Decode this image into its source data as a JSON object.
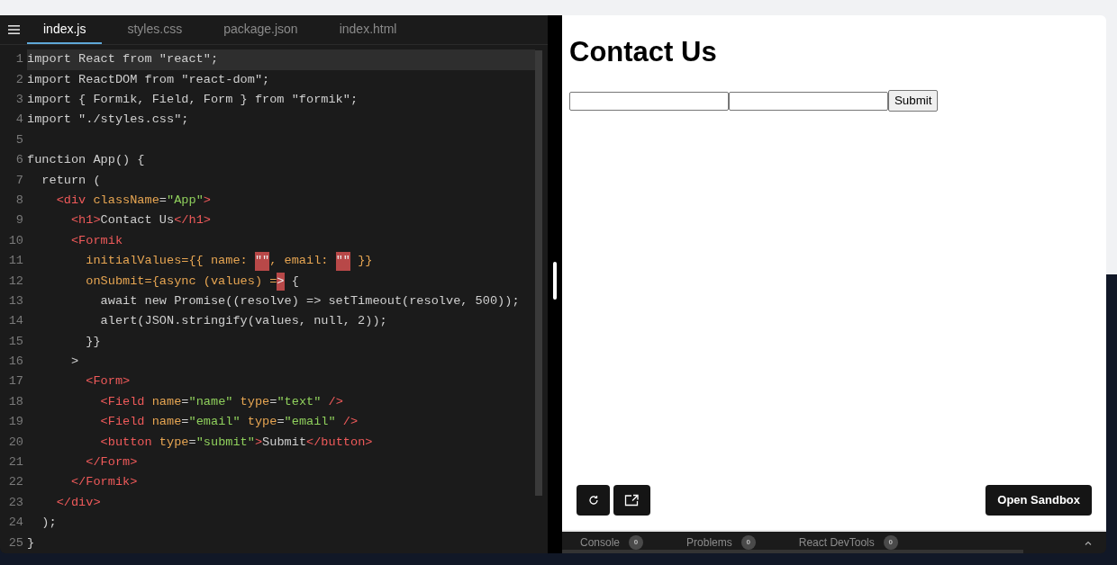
{
  "editor": {
    "tabs": [
      {
        "label": "index.js",
        "selected": true
      },
      {
        "label": "styles.css",
        "selected": false
      },
      {
        "label": "package.json",
        "selected": false
      },
      {
        "label": "index.html",
        "selected": false
      }
    ],
    "lines": [
      {
        "number": "1",
        "active": true,
        "tokens": [
          {
            "kind": "plain",
            "text": "import React from \"react\";"
          }
        ]
      },
      {
        "number": "2",
        "active": false,
        "tokens": [
          {
            "kind": "plain",
            "text": "import ReactDOM from \"react-dom\";"
          }
        ]
      },
      {
        "number": "3",
        "active": false,
        "tokens": [
          {
            "kind": "plain",
            "text": "import { Formik, Field, Form } from \"formik\";"
          }
        ]
      },
      {
        "number": "4",
        "active": false,
        "tokens": [
          {
            "kind": "plain",
            "text": "import \"./styles.css\";"
          }
        ]
      },
      {
        "number": "5",
        "active": false
      },
      {
        "number": "6",
        "active": false,
        "tokens": [
          {
            "kind": "plain",
            "text": "function App() {"
          }
        ]
      },
      {
        "number": "7",
        "active": false,
        "tokens": [
          {
            "kind": "plain",
            "text": "  return ("
          }
        ]
      },
      {
        "number": "8",
        "active": false,
        "tokens": [
          {
            "kind": "tag",
            "text": "    <div "
          },
          {
            "kind": "attr",
            "text": "className"
          },
          {
            "kind": "plain",
            "text": "="
          },
          {
            "kind": "string",
            "text": "\"App\""
          },
          {
            "kind": "tag",
            "text": ">"
          }
        ]
      },
      {
        "number": "9",
        "active": false,
        "tokens": [
          {
            "kind": "tag",
            "text": "      <h1>"
          },
          {
            "kind": "plain",
            "text": "Contact Us"
          },
          {
            "kind": "tag",
            "text": "</h1>"
          }
        ]
      },
      {
        "number": "10",
        "active": false,
        "tokens": [
          {
            "kind": "tag",
            "text": "      <Formik"
          }
        ]
      },
      {
        "number": "11",
        "active": false,
        "tokens": [
          {
            "kind": "attr",
            "text": "        initialValues={{ name: "
          },
          {
            "kind": "error",
            "text": "\"\""
          },
          {
            "kind": "attr",
            "text": ", email: "
          },
          {
            "kind": "error",
            "text": "\"\""
          },
          {
            "kind": "attr",
            "text": " }}"
          }
        ]
      },
      {
        "number": "12",
        "active": false,
        "tokens": [
          {
            "kind": "attr",
            "text": "        onSubmit={async (values) ="
          },
          {
            "kind": "error",
            "text": ">"
          },
          {
            "kind": "plain",
            "text": " {"
          }
        ]
      },
      {
        "number": "13",
        "active": false,
        "tokens": [
          {
            "kind": "plain",
            "text": "          await new Promise((resolve) => setTimeout(resolve, 500));"
          }
        ]
      },
      {
        "number": "14",
        "active": false,
        "tokens": [
          {
            "kind": "plain",
            "text": "          alert(JSON.stringify(values, null, 2));"
          }
        ]
      },
      {
        "number": "15",
        "active": false,
        "tokens": [
          {
            "kind": "plain",
            "text": "        }}"
          }
        ]
      },
      {
        "number": "16",
        "active": false,
        "tokens": [
          {
            "kind": "plain",
            "text": "      >"
          }
        ]
      },
      {
        "number": "17",
        "active": false,
        "tokens": [
          {
            "kind": "tag",
            "text": "        <Form>"
          }
        ]
      },
      {
        "number": "18",
        "active": false,
        "tokens": [
          {
            "kind": "tag",
            "text": "          <Field "
          },
          {
            "kind": "attr",
            "text": "name"
          },
          {
            "kind": "plain",
            "text": "="
          },
          {
            "kind": "string",
            "text": "\"name\" "
          },
          {
            "kind": "attr",
            "text": "type"
          },
          {
            "kind": "plain",
            "text": "="
          },
          {
            "kind": "string",
            "text": "\"text\" "
          },
          {
            "kind": "tag",
            "text": "/>"
          }
        ]
      },
      {
        "number": "19",
        "active": false,
        "tokens": [
          {
            "kind": "tag",
            "text": "          <Field "
          },
          {
            "kind": "attr",
            "text": "name"
          },
          {
            "kind": "plain",
            "text": "="
          },
          {
            "kind": "string",
            "text": "\"email\" "
          },
          {
            "kind": "attr",
            "text": "type"
          },
          {
            "kind": "plain",
            "text": "="
          },
          {
            "kind": "string",
            "text": "\"email\" "
          },
          {
            "kind": "tag",
            "text": "/>"
          }
        ]
      },
      {
        "number": "20",
        "active": false,
        "tokens": [
          {
            "kind": "tag",
            "text": "          <button "
          },
          {
            "kind": "attr",
            "text": "type"
          },
          {
            "kind": "plain",
            "text": "="
          },
          {
            "kind": "string",
            "text": "\"submit\""
          },
          {
            "kind": "tag",
            "text": ">"
          },
          {
            "kind": "plain",
            "text": "Submit"
          },
          {
            "kind": "tag",
            "text": "</button>"
          }
        ]
      },
      {
        "number": "21",
        "active": false,
        "tokens": [
          {
            "kind": "tag",
            "text": "        </Form>"
          }
        ]
      },
      {
        "number": "22",
        "active": false,
        "tokens": [
          {
            "kind": "tag",
            "text": "      </Formik>"
          }
        ]
      },
      {
        "number": "23",
        "active": false,
        "tokens": [
          {
            "kind": "tag",
            "text": "    </div>"
          }
        ]
      },
      {
        "number": "24",
        "active": false,
        "tokens": [
          {
            "kind": "plain",
            "text": "  );"
          }
        ]
      },
      {
        "number": "25",
        "active": false,
        "tokens": [
          {
            "kind": "plain",
            "text": "}"
          }
        ]
      }
    ]
  },
  "preview": {
    "heading": "Contact Us",
    "submit": "Submit",
    "open_sandbox": "Open Sandbox"
  },
  "console": {
    "tabs": [
      {
        "label": "Console",
        "count": "0"
      },
      {
        "label": "Problems",
        "count": "0"
      },
      {
        "label": "React DevTools",
        "count": "0"
      }
    ]
  }
}
